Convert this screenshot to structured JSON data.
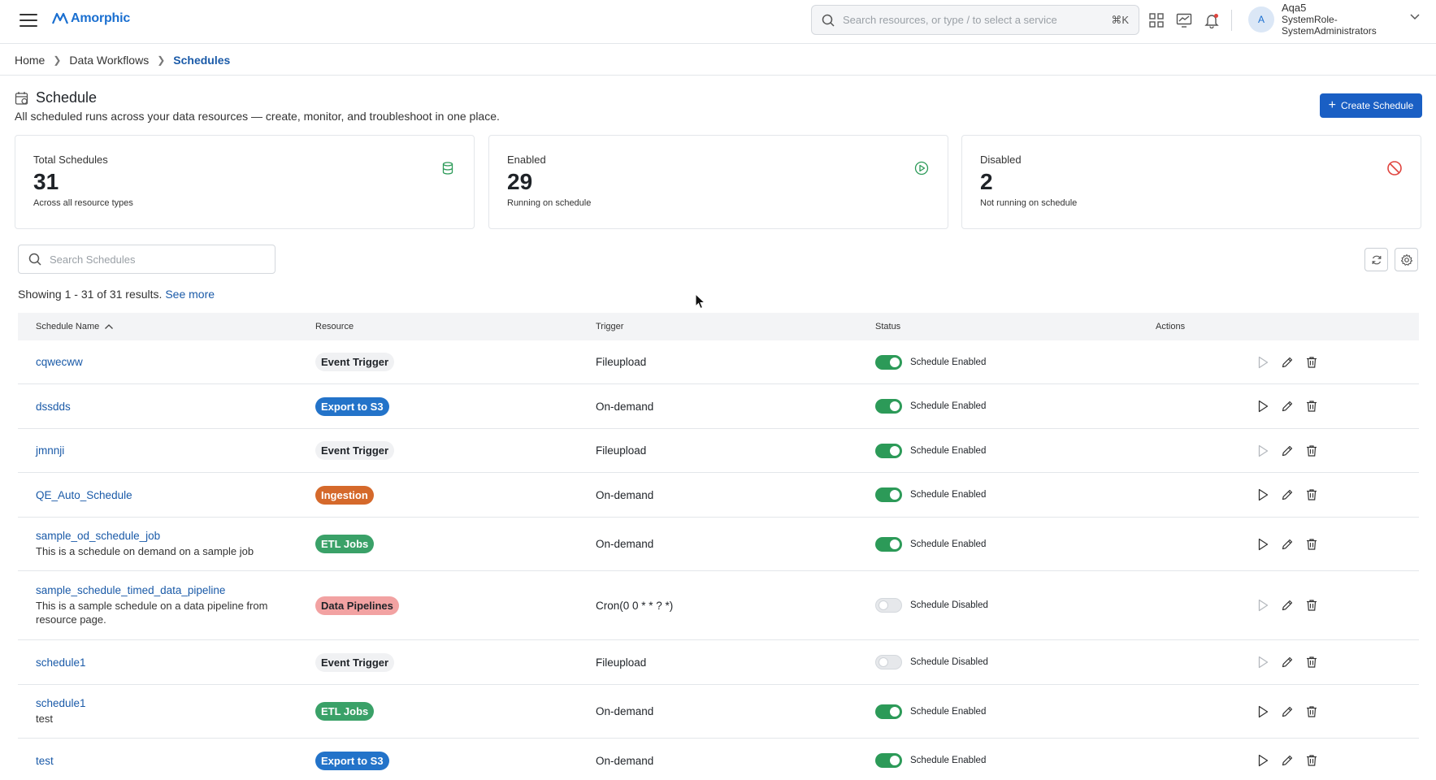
{
  "app": {
    "logo_text": "Amorphic",
    "brand_color": "#1a6fd0"
  },
  "header": {
    "search_placeholder": "Search resources, or type / to select a service",
    "shortcut": "⌘K",
    "user": {
      "initial": "A",
      "name": "Aqa5",
      "role_line1": "SystemRole-",
      "role_line2": "SystemAdministrators"
    }
  },
  "breadcrumb": {
    "items": [
      "Home",
      "Data Workflows",
      "Schedules"
    ]
  },
  "page": {
    "title": "Schedule",
    "subtitle": "All scheduled runs across your data resources — create, monitor, and troubleshoot in one place.",
    "create_label": "Create Schedule"
  },
  "stats": [
    {
      "label": "Total Schedules",
      "value": "31",
      "caption": "Across all resource types",
      "icon": "database-icon"
    },
    {
      "label": "Enabled",
      "value": "29",
      "caption": "Running on schedule",
      "icon": "play-circle-icon"
    },
    {
      "label": "Disabled",
      "value": "2",
      "caption": "Not running on schedule",
      "icon": "ban-icon"
    }
  ],
  "toolbar": {
    "search_placeholder": "Search Schedules",
    "results_text": "Showing 1 - 31 of 31 results.",
    "see_more": "See more"
  },
  "table": {
    "columns": [
      "Schedule Name",
      "Resource",
      "Trigger",
      "Status",
      "Actions"
    ],
    "rows": [
      {
        "name": "cqwecww",
        "desc": "",
        "resource": "Event Trigger",
        "resource_type": "event",
        "trigger": "Fileupload",
        "enabled": true,
        "status": "Schedule Enabled",
        "run_active": false
      },
      {
        "name": "dssdds",
        "desc": "",
        "resource": "Export to S3",
        "resource_type": "export",
        "trigger": "On-demand",
        "enabled": true,
        "status": "Schedule Enabled",
        "run_active": true
      },
      {
        "name": "jmnnji",
        "desc": "",
        "resource": "Event Trigger",
        "resource_type": "event",
        "trigger": "Fileupload",
        "enabled": true,
        "status": "Schedule Enabled",
        "run_active": false
      },
      {
        "name": "QE_Auto_Schedule",
        "desc": "",
        "resource": "Ingestion",
        "resource_type": "ingest",
        "trigger": "On-demand",
        "enabled": true,
        "status": "Schedule Enabled",
        "run_active": true
      },
      {
        "name": "sample_od_schedule_job",
        "desc": "This is a schedule on demand on a sample job",
        "resource": "ETL Jobs",
        "resource_type": "etl",
        "trigger": "On-demand",
        "enabled": true,
        "status": "Schedule Enabled",
        "run_active": true
      },
      {
        "name": "sample_schedule_timed_data_pipeline",
        "desc": "This is a sample schedule on a data pipeline from resource page.",
        "resource": "Data Pipelines",
        "resource_type": "pipe",
        "trigger": "Cron(0 0 * * ? *)",
        "enabled": false,
        "status": "Schedule Disabled",
        "run_active": false
      },
      {
        "name": "schedule1",
        "desc": "",
        "resource": "Event Trigger",
        "resource_type": "event",
        "trigger": "Fileupload",
        "enabled": false,
        "status": "Schedule Disabled",
        "run_active": false
      },
      {
        "name": "schedule1",
        "desc": "test",
        "resource": "ETL Jobs",
        "resource_type": "etl",
        "trigger": "On-demand",
        "enabled": true,
        "status": "Schedule Enabled",
        "run_active": true
      },
      {
        "name": "test",
        "desc": "",
        "resource": "Export to S3",
        "resource_type": "export",
        "trigger": "On-demand",
        "enabled": true,
        "status": "Schedule Enabled",
        "run_active": true
      }
    ]
  },
  "colors": {
    "primary": "#1a5fc4",
    "link": "#1a5aa8",
    "toggle_on": "#2c9a58",
    "export_tag": "#2373c9",
    "ingestion_tag": "#d5692b",
    "etl_tag": "#3aa168",
    "pipeline_tag": "#f2a2a2",
    "disabled_icon": "#e0443e"
  }
}
